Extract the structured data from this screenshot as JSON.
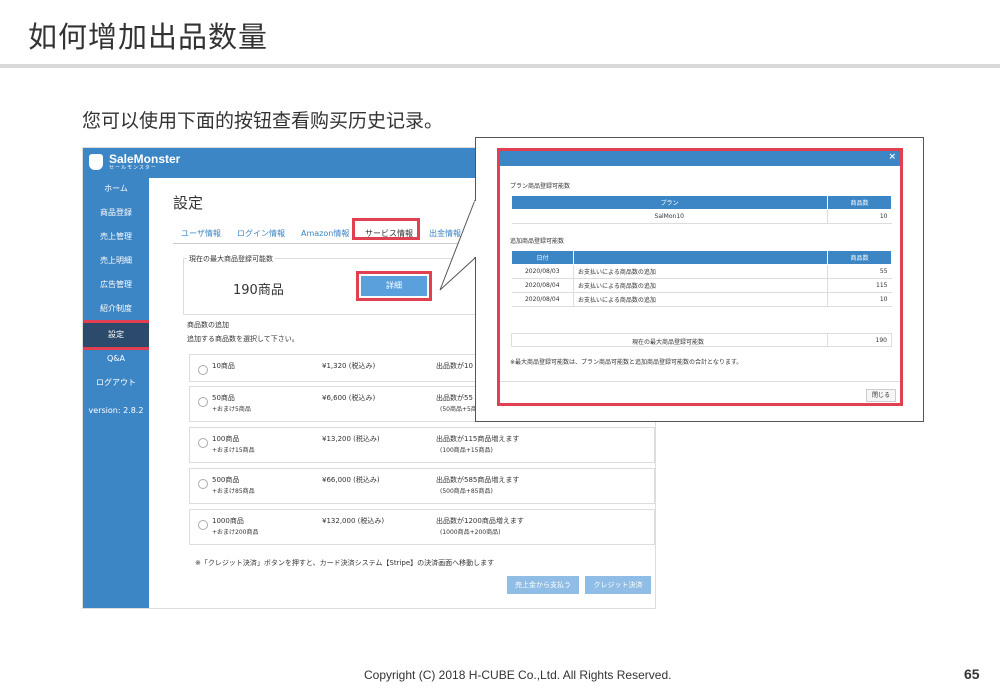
{
  "slide": {
    "title": "如何增加出品数量",
    "subtitle": "您可以使用下面的按钮查看购买历史记录。",
    "footer": "Copyright (C) 2018 H-CUBE Co.,Ltd. All Rights Reserved.",
    "page_number": "65"
  },
  "app": {
    "logo": {
      "name": "SaleMonster",
      "sub": "セールモンスター",
      "icon": "monster-logo-icon"
    },
    "sidebar": {
      "items": [
        {
          "label": "ホーム"
        },
        {
          "label": "商品登録"
        },
        {
          "label": "売上管理"
        },
        {
          "label": "売上明細"
        },
        {
          "label": "広告管理"
        },
        {
          "label": "紹介制度"
        },
        {
          "label": "設定"
        },
        {
          "label": "Q&A"
        },
        {
          "label": "ログアウト"
        },
        {
          "label": "version: 2.8.2"
        }
      ],
      "active_index": 6
    },
    "page_title": "設定",
    "tabs": [
      {
        "label": "ユーザ情報"
      },
      {
        "label": "ログイン情報"
      },
      {
        "label": "Amazon情報"
      },
      {
        "label": "サービス情報"
      },
      {
        "label": "出金情報"
      }
    ],
    "active_tab": 3,
    "max_count_legend": "現在の最大商品登録可能数",
    "max_count_value": "190商品",
    "detail_button": "詳細",
    "add_legend": "商品数の追加",
    "add_desc": "追加する商品数を選択して下さい。",
    "options": [
      {
        "name": "10商品",
        "bonus": "",
        "price": "¥1,320 (税込み)",
        "increase": "出品数が10",
        "increase_sub": ""
      },
      {
        "name": "50商品",
        "bonus": "+おまけ5商品",
        "price": "¥6,600 (税込み)",
        "increase": "出品数が55",
        "increase_sub": "(50商品+5商"
      },
      {
        "name": "100商品",
        "bonus": "+おまけ15商品",
        "price": "¥13,200 (税込み)",
        "increase": "出品数が115商品増えます",
        "increase_sub": "(100商品+15商品)"
      },
      {
        "name": "500商品",
        "bonus": "+おまけ85商品",
        "price": "¥66,000 (税込み)",
        "increase": "出品数が585商品増えます",
        "increase_sub": "(500商品+85商品)"
      },
      {
        "name": "1000商品",
        "bonus": "+おまけ200商品",
        "price": "¥132,000 (税込み)",
        "increase": "出品数が1200商品増えます",
        "increase_sub": "(1000商品+200商品)"
      }
    ],
    "note": "※「クレジット決済」ボタンを押すと、カード決済システム【Stripe】の決済画面へ移動します",
    "btn_sales": "売上金から支払う",
    "btn_credit": "クレジット決済"
  },
  "modal": {
    "close_icon": "×",
    "plan_label": "プラン商品登録可能数",
    "plan_headers": [
      "プラン",
      "商品数"
    ],
    "plan_rows": [
      [
        "SalMon10",
        "10"
      ]
    ],
    "add_label": "追加商品登録可能数",
    "add_headers": [
      "日付",
      "",
      "商品数"
    ],
    "add_rows": [
      [
        "2020/08/03",
        "お支払いによる商品数の追加",
        "55"
      ],
      [
        "2020/08/04",
        "お支払いによる商品数の追加",
        "115"
      ],
      [
        "2020/08/04",
        "お支払いによる商品数の追加",
        "10"
      ]
    ],
    "total_label": "現在の最大商品登録可能数",
    "total_value": "190",
    "note": "※最大商品登録可能数は、プラン商品可能数と追加商品登録可能数の合計となります。",
    "close_button": "閉じる"
  },
  "colors": {
    "accent": "#3d86c6",
    "sidebar_active": "#2c4a6b",
    "highlight": "#e04050",
    "button_light": "#8fbde5"
  }
}
